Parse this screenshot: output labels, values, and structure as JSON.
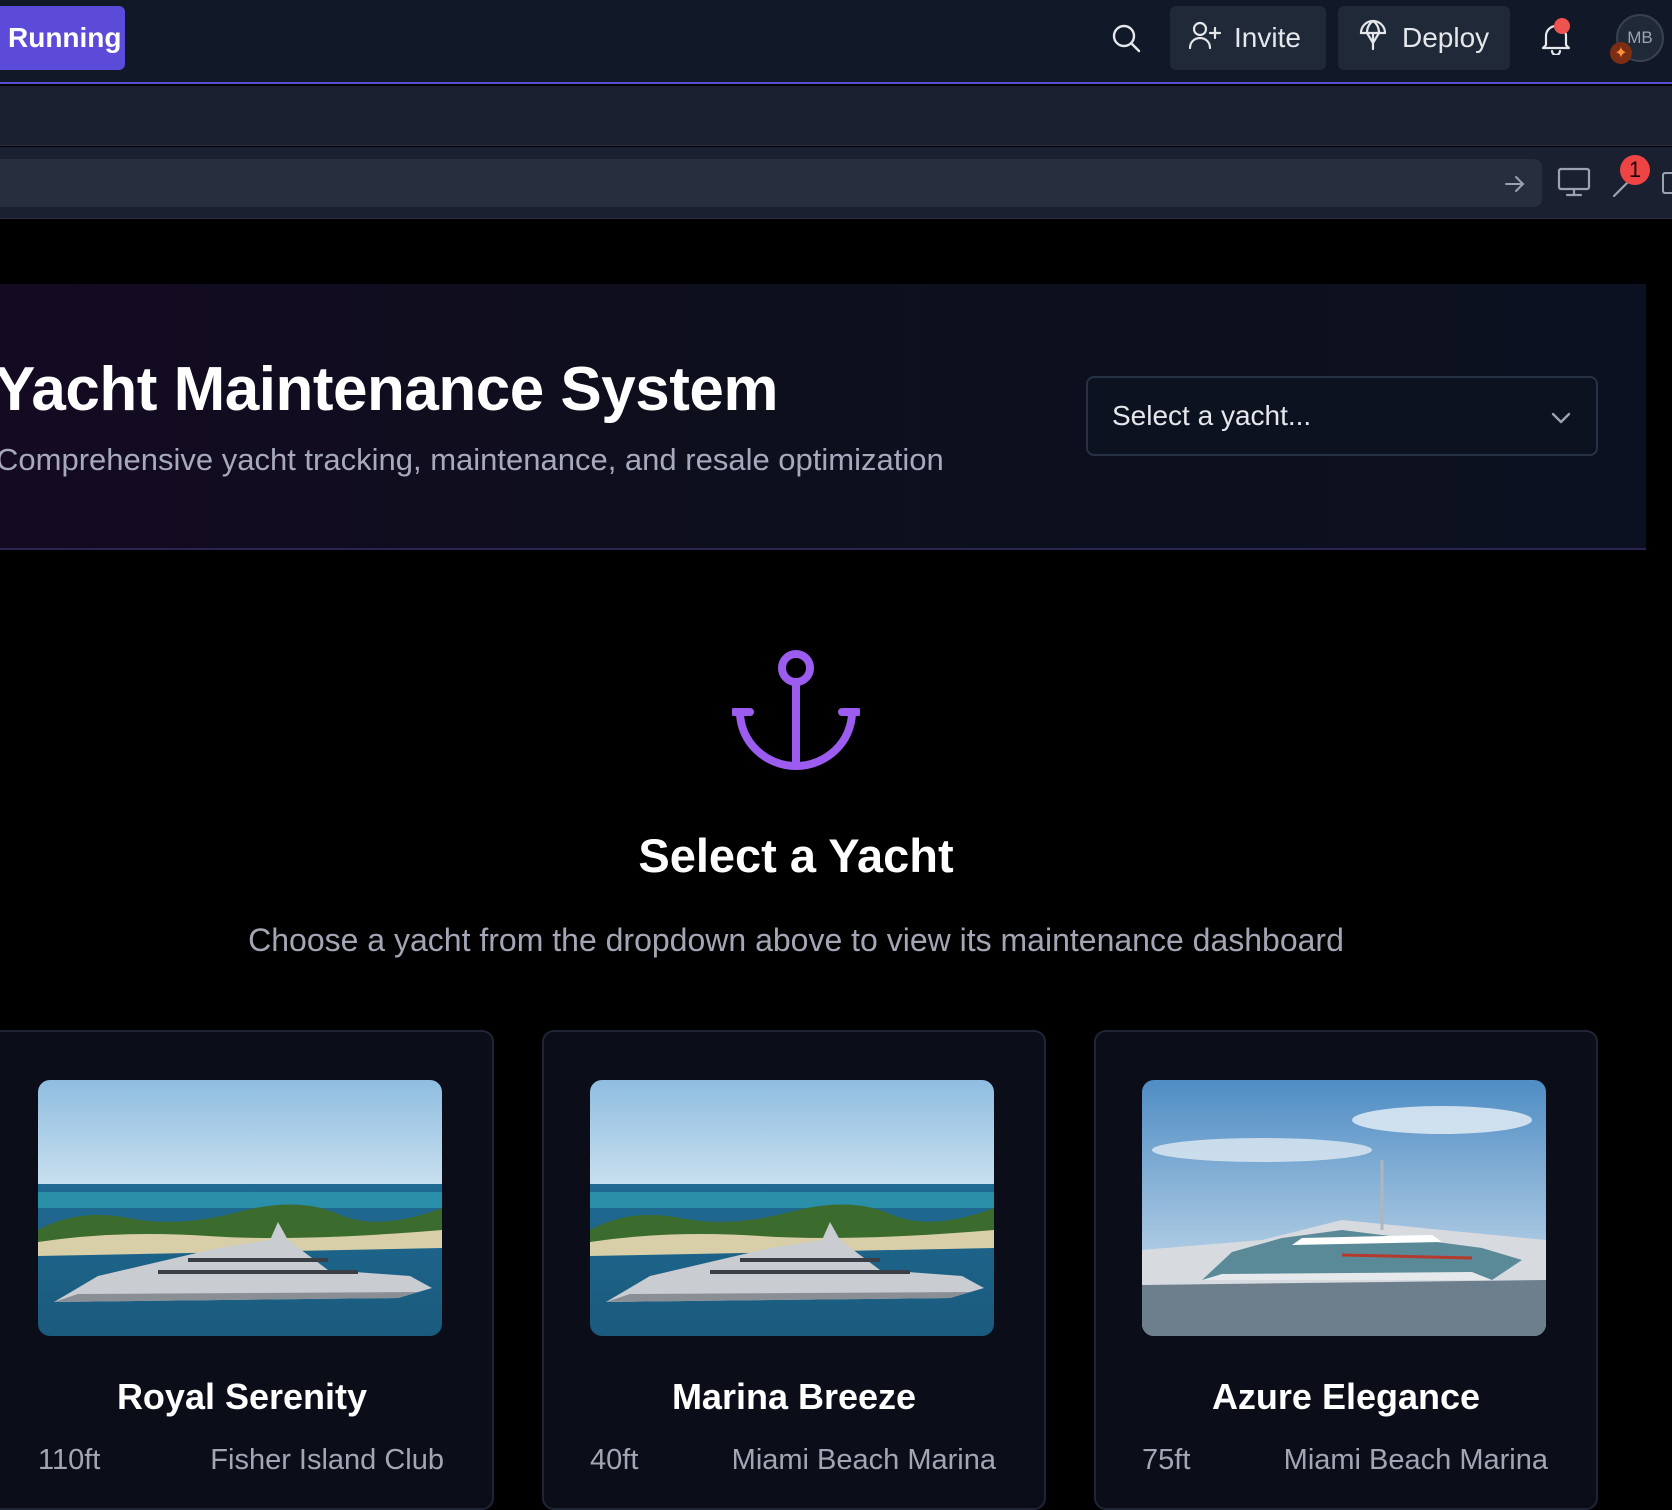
{
  "topbar": {
    "running_label": "Running",
    "invite_label": "Invite",
    "deploy_label": "Deploy",
    "avatar_initials": "MB",
    "accent": "#5b4bd8"
  },
  "toolbar": {
    "notification_count": "1"
  },
  "hero": {
    "title": "Yacht Maintenance System",
    "subtitle": "Comprehensive yacht tracking, maintenance, and resale optimization",
    "select_placeholder": "Select a yacht..."
  },
  "empty_state": {
    "icon": "anchor-icon",
    "title": "Select a Yacht",
    "description": "Choose a yacht from the dropdown above to view its maintenance dashboard",
    "icon_color": "#9d5cf0"
  },
  "yachts": [
    {
      "name": "Royal Serenity",
      "length": "110ft",
      "marina": "Fisher Island Club"
    },
    {
      "name": "Marina Breeze",
      "length": "40ft",
      "marina": "Miami Beach Marina"
    },
    {
      "name": "Azure Elegance",
      "length": "75ft",
      "marina": "Miami Beach Marina"
    }
  ]
}
